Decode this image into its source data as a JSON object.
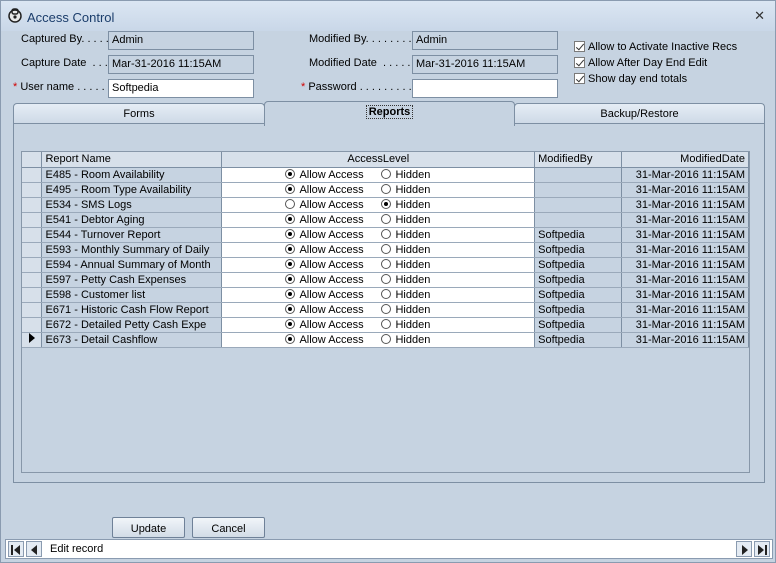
{
  "window": {
    "title": "Access Control"
  },
  "header": {
    "captured_by_label": "Captured By. . . . .",
    "captured_by_value": "Admin",
    "capture_date_label": "Capture Date  . . .",
    "capture_date_value": "Mar-31-2016 11:15AM",
    "username_label": "User name . . . . . .",
    "username_value": "Softpedia",
    "modified_by_label": "Modified By. . . . . . . .",
    "modified_by_value": "Admin",
    "modified_date_label": "Modified Date  . . . . .",
    "modified_date_value": "Mar-31-2016 11:15AM",
    "password_label": "Password . . . . . . . . .",
    "password_value": "",
    "required_mark": "*"
  },
  "options": [
    {
      "label": "Allow to Activate Inactive Recs",
      "checked": true
    },
    {
      "label": "Allow After Day End Edit",
      "checked": true
    },
    {
      "label": "Show day end totals",
      "checked": true
    }
  ],
  "tabs": [
    {
      "label": "Forms"
    },
    {
      "label": "Reports"
    },
    {
      "label": "Backup/Restore"
    }
  ],
  "grid": {
    "columns": [
      "Report Name",
      "AccessLevel",
      "ModifiedBy",
      "ModifiedDate"
    ],
    "option_allow": "Allow Access",
    "option_hidden": "Hidden",
    "rows": [
      {
        "name": "E485 - Room Availability",
        "access": "allow",
        "modified_by": "",
        "modified_date": "31-Mar-2016 11:15AM"
      },
      {
        "name": "E495 - Room Type Availability",
        "access": "allow",
        "modified_by": "",
        "modified_date": "31-Mar-2016 11:15AM"
      },
      {
        "name": "E534 - SMS Logs",
        "access": "hidden",
        "modified_by": "",
        "modified_date": "31-Mar-2016 11:15AM"
      },
      {
        "name": "E541 - Debtor Aging",
        "access": "allow",
        "modified_by": "",
        "modified_date": "31-Mar-2016 11:15AM"
      },
      {
        "name": "E544 - Turnover Report",
        "access": "allow",
        "modified_by": "Softpedia",
        "modified_date": "31-Mar-2016 11:15AM"
      },
      {
        "name": "E593 - Monthly Summary of Daily",
        "access": "allow",
        "modified_by": "Softpedia",
        "modified_date": "31-Mar-2016 11:15AM"
      },
      {
        "name": "E594 - Annual Summary of Month",
        "access": "allow",
        "modified_by": "Softpedia",
        "modified_date": "31-Mar-2016 11:15AM"
      },
      {
        "name": "E597 - Petty Cash Expenses",
        "access": "allow",
        "modified_by": "Softpedia",
        "modified_date": "31-Mar-2016 11:15AM"
      },
      {
        "name": "E598 - Customer list",
        "access": "allow",
        "modified_by": "Softpedia",
        "modified_date": "31-Mar-2016 11:15AM"
      },
      {
        "name": "E671 - Historic Cash Flow Report",
        "access": "allow",
        "modified_by": "Softpedia",
        "modified_date": "31-Mar-2016 11:15AM"
      },
      {
        "name": "E672 - Detailed Petty Cash Expe",
        "access": "allow",
        "modified_by": "Softpedia",
        "modified_date": "31-Mar-2016 11:15AM"
      },
      {
        "name": "E673 - Detail Cashflow",
        "access": "allow",
        "modified_by": "Softpedia",
        "modified_date": "31-Mar-2016 11:15AM",
        "current": true
      }
    ]
  },
  "buttons": {
    "update": "Update",
    "cancel": "Cancel"
  },
  "navigator": {
    "status_text": "Edit record"
  }
}
